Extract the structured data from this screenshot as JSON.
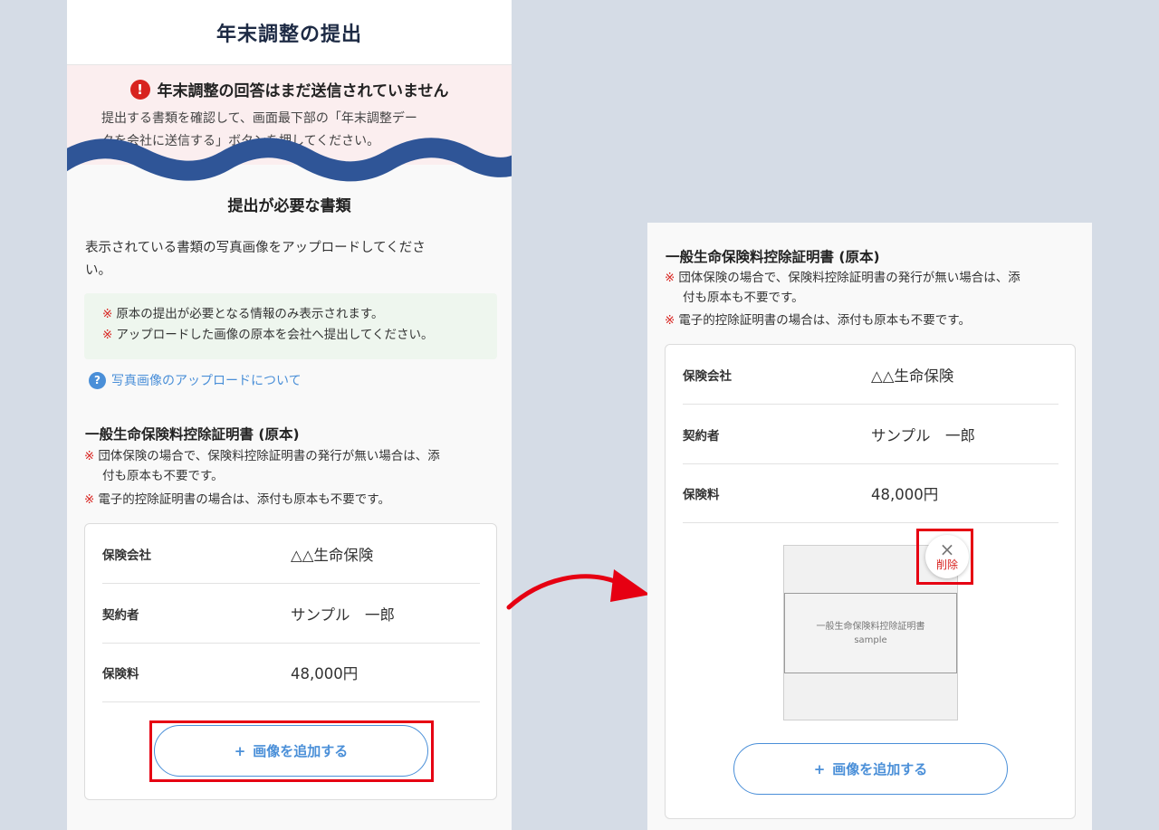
{
  "header": {
    "title": "年末調整の提出"
  },
  "alert": {
    "icon": "exclamation-icon",
    "icon_glyph": "!",
    "title": "年末調整の回答はまだ送信されていません",
    "body_line1": "提出する書類を確認して、画面最下部の「年末調整デー",
    "body_line2": "タを会社に送信する」ボタンを押してください。"
  },
  "section": {
    "title": "提出が必要な書類",
    "description_line1": "表示されている書類の写真画像をアップロードしてくださ",
    "description_line2": "い。",
    "notes": [
      "原本の提出が必要となる情報のみ表示されます。",
      "アップロードした画像の原本を会社へ提出してください。"
    ],
    "kome": "※",
    "help_icon_glyph": "?",
    "help_link": "写真画像のアップロードについて"
  },
  "document": {
    "title": "一般生命保険料控除証明書 (原本)",
    "note1_line1": "団体保険の場合で、保険料控除証明書の発行が無い場合は、添",
    "note1_line2": "付も原本も不要です。",
    "note2": "電子的控除証明書の場合は、添付も原本も不要です。",
    "rows": [
      {
        "label": "保険会社",
        "value": "△△生命保険"
      },
      {
        "label": "契約者",
        "value": "サンプル　一郎"
      },
      {
        "label": "保険料",
        "value": "48,000円"
      }
    ],
    "add_button_plus": "+",
    "add_button_label": "画像を追加する"
  },
  "uploaded_image": {
    "caption_line1": "一般生命保険料控除証明書",
    "caption_line2": "sample",
    "delete_glyph": "×",
    "delete_label": "削除"
  },
  "colors": {
    "accent": "#4a8fd8",
    "alert_red": "#d8231f",
    "highlight_red": "#e60012",
    "wave": "#2f5597",
    "background": "#d5dce6"
  }
}
